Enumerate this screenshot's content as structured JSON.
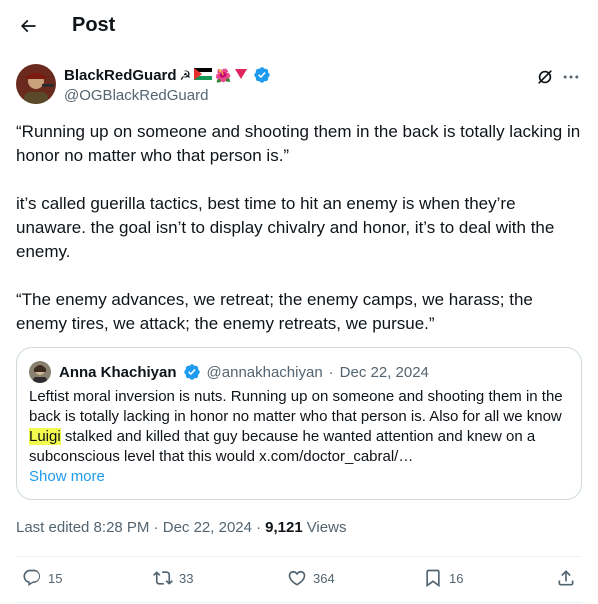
{
  "header": {
    "title": "Post"
  },
  "author": {
    "display_name": "BlackRedGuard",
    "emojis": [
      "☭",
      "🇵🇸",
      "🌺",
      "🔻"
    ],
    "handle": "@OGBlackRedGuard"
  },
  "post": {
    "paragraphs": [
      "“Running up on someone and shooting them in the back is totally lacking in honor no matter who that person is.”",
      "it’s called guerilla tactics, best time to hit an enemy is when they’re unaware. the goal isn’t to display chivalry and honor, it’s to deal with the enemy.",
      "“The enemy advances, we retreat; the enemy camps, we harass; the enemy tires, we attack; the enemy retreats, we pursue.”"
    ]
  },
  "quote": {
    "display_name": "Anna Khachiyan",
    "handle": "@annakhachiyan",
    "separator": "·",
    "date": "Dec 22, 2024",
    "text_before": "Leftist moral inversion is nuts. Running up on someone and shooting them in the back is totally lacking in honor no matter who that person is. Also for all we know ",
    "highlight": "Luigi",
    "text_after": " stalked and killed that guy because he wanted attention and knew on a subconscious level that this would x.com/doctor_cabral/…",
    "show_more": "Show more"
  },
  "meta": {
    "edited": "Last edited 8:28 PM · Dec 22, 2024 ·",
    "views_count": "9,121",
    "views_label": "Views"
  },
  "actions": {
    "replies": "15",
    "reposts": "33",
    "likes": "364",
    "bookmarks": "16"
  },
  "colors": {
    "text": "#0f1419",
    "muted": "#536471",
    "accent": "#1d9bf0",
    "highlight": "#f2fa4b",
    "border": "#cfd9de"
  }
}
